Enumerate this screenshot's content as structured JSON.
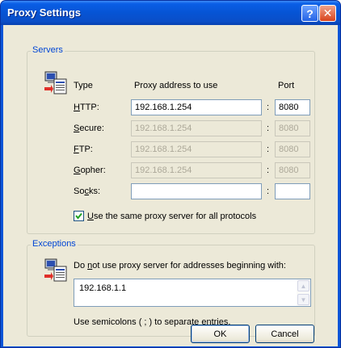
{
  "window": {
    "title": "Proxy Settings",
    "help_glyph": "?",
    "close_glyph": "✕"
  },
  "servers": {
    "legend": "Servers",
    "col_type": "Type",
    "col_address": "Proxy address to use",
    "col_port": "Port",
    "colon": ":",
    "rows": [
      {
        "key": "H",
        "rest": "TTP:",
        "address": "192.168.1.254",
        "port": "8080",
        "enabled": true
      },
      {
        "key": "S",
        "rest": "ecure:",
        "address": "192.168.1.254",
        "port": "8080",
        "enabled": false
      },
      {
        "key": "F",
        "rest": "TP:",
        "address": "192.168.1.254",
        "port": "8080",
        "enabled": false
      },
      {
        "key": "G",
        "rest": "opher:",
        "address": "192.168.1.254",
        "port": "8080",
        "enabled": false
      },
      {
        "pre": "So",
        "key": "c",
        "rest": "ks:",
        "address": "",
        "port": "",
        "enabled": true
      }
    ],
    "same_proxy": {
      "key": "U",
      "rest": "se the same proxy server for all protocols",
      "checked": true
    }
  },
  "exceptions": {
    "legend": "Exceptions",
    "instr_pre": "Do ",
    "instr_key": "n",
    "instr_rest": "ot use proxy server for addresses beginning with:",
    "value": "192.168.1.1",
    "hint": "Use semicolons ( ; ) to separate entries."
  },
  "buttons": {
    "ok": "OK",
    "cancel": "Cancel"
  },
  "icons": [
    "network-computer-icon",
    "network-computer-icon"
  ],
  "colors": {
    "title_bar": "#0a55d8",
    "dialog_bg": "#ece9d8",
    "group_label": "#0046d5"
  }
}
